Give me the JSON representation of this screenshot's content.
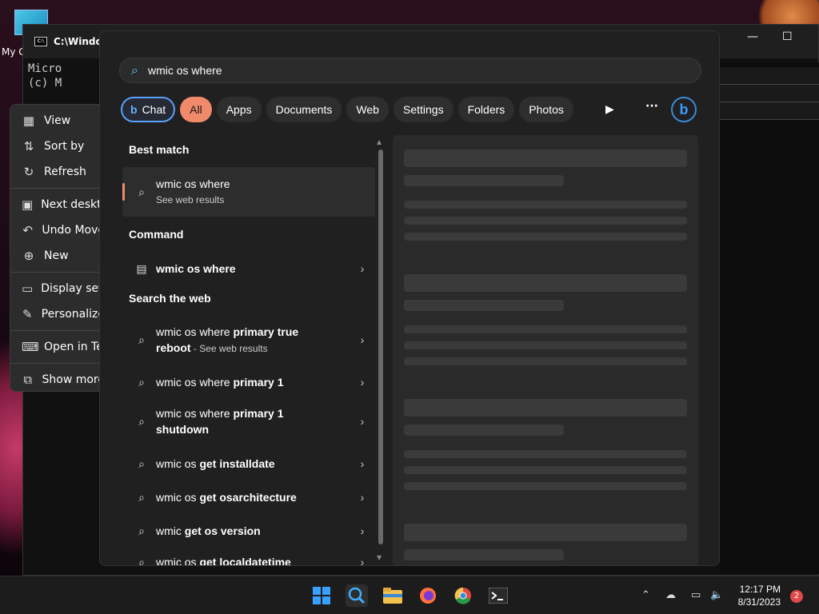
{
  "desktop": {
    "icon_label": "My C"
  },
  "console": {
    "title": "C:\\Windo",
    "lines": [
      "Micro",
      "(c) M"
    ],
    "min_glyph": "—",
    "max_glyph": "☐"
  },
  "context_menu": {
    "items": [
      {
        "label": "View",
        "icon": "grid-icon"
      },
      {
        "label": "Sort by",
        "icon": "sort-icon"
      },
      {
        "label": "Refresh",
        "icon": "refresh-icon"
      },
      {
        "label": "Next deskto",
        "icon": "next-desktop-icon"
      },
      {
        "label": "Undo Move",
        "icon": "undo-icon"
      },
      {
        "label": "New",
        "icon": "plus-icon"
      },
      {
        "label": "Display sett",
        "icon": "display-icon"
      },
      {
        "label": "Personalize",
        "icon": "pen-icon"
      },
      {
        "label": "Open in Ter",
        "icon": "terminal-icon"
      },
      {
        "label": "Show more",
        "icon": "more-icon"
      }
    ]
  },
  "search": {
    "query": "wmic os where",
    "chips": [
      "Chat",
      "All",
      "Apps",
      "Documents",
      "Web",
      "Settings",
      "Folders",
      "Photos"
    ],
    "bing_letter": "b",
    "play_glyph": "▶",
    "more_glyph": "···"
  },
  "results": {
    "best_match_heading": "Best match",
    "best_match": {
      "title": "wmic os where",
      "subtitle": "See web results"
    },
    "command_heading": "Command",
    "command": {
      "title": "wmic os where"
    },
    "web_heading": "Search the web",
    "web": [
      {
        "prefix": "wmic os where ",
        "bold": "primary true",
        "line2_bold": "reboot",
        "suffix": " - See web results"
      },
      {
        "prefix": "wmic os where ",
        "bold": "primary 1"
      },
      {
        "prefix": "wmic os where ",
        "bold": "primary 1",
        "line2_bold": "shutdown"
      },
      {
        "prefix": "wmic os ",
        "bold": "get installdate"
      },
      {
        "prefix": "wmic os ",
        "bold": "get osarchitecture"
      },
      {
        "prefix": "wmic ",
        "bold": "get os version"
      },
      {
        "prefix": "wmic os ",
        "bold": "get localdatetime"
      }
    ]
  },
  "taskbar": {
    "clock_time": "12:17 PM",
    "clock_date": "8/31/2023",
    "notification_count": "2"
  },
  "colors": {
    "accent_chip": "#f08a6a",
    "search_icon": "#60cdff",
    "bing": "#3a9aff",
    "notification": "#e04a4a"
  }
}
